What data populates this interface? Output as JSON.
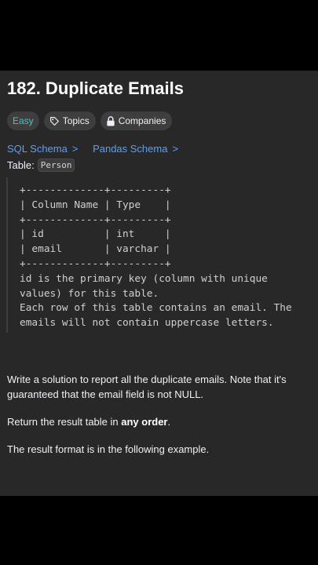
{
  "problem": {
    "title": "182. Duplicate Emails",
    "difficulty": "Easy",
    "topics_label": "Topics",
    "companies_label": "Companies"
  },
  "schema_links": {
    "sql": "SQL Schema",
    "pandas": "Pandas Schema",
    "chevron": ">"
  },
  "table": {
    "prefix": "Table:",
    "name": "Person"
  },
  "schema_block": "+-------------+---------+\n| Column Name | Type    |\n+-------------+---------+\n| id          | int     |\n| email       | varchar |\n+-------------+---------+\nid is the primary key (column with unique\nvalues) for this table.\nEach row of this table contains an email. The\nemails will not contain uppercase letters.",
  "description": {
    "p1": "Write a solution to report all the duplicate emails. Note that it's guaranteed that the email field is not NULL.",
    "p2_start": "Return the result table in ",
    "p2_bold": "any order",
    "p2_end": ".",
    "p3": "The result format is in the following example."
  },
  "colors": {
    "background": "#282828",
    "easy": "#46c6c2",
    "link": "#5d9ff5",
    "pill": "#3e3e3e"
  },
  "icons": [
    "tag-icon",
    "lock-icon",
    "chevron-right-icon"
  ]
}
